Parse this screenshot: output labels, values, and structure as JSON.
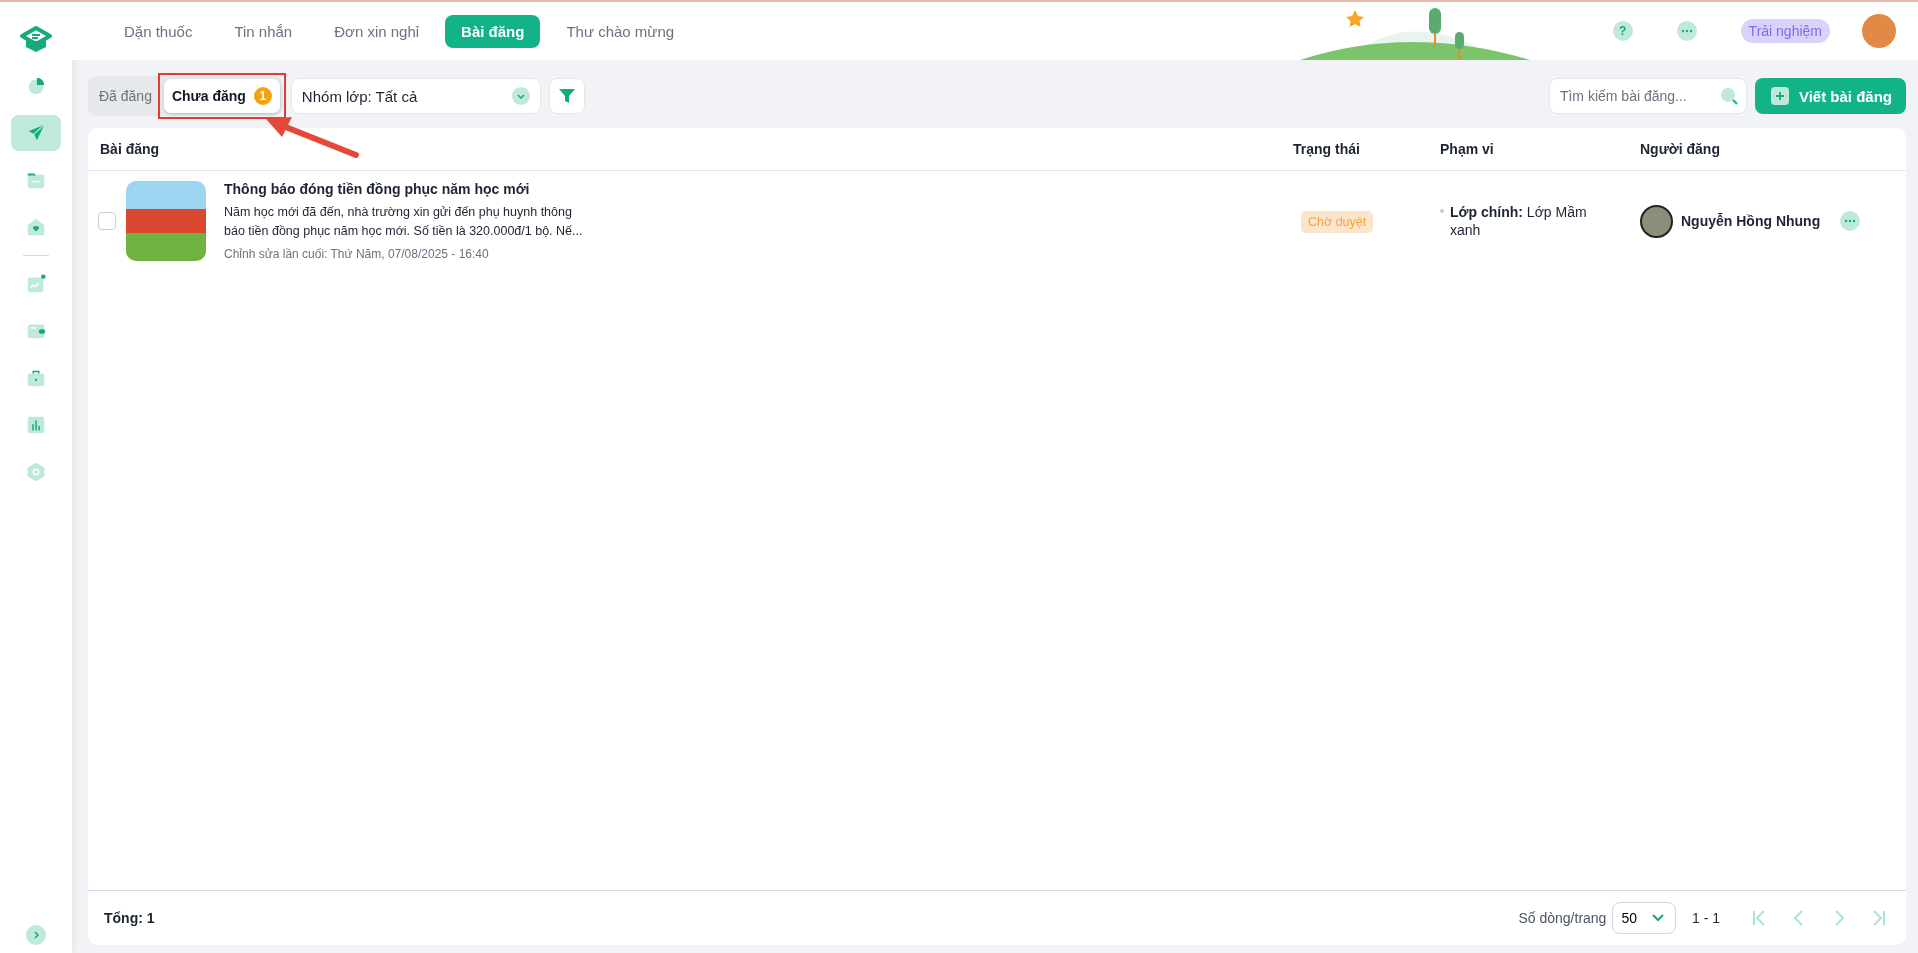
{
  "sidebar": {
    "groups": [
      [
        {
          "kind": "pie",
          "selected": false
        },
        {
          "kind": "send",
          "selected": true
        },
        {
          "kind": "folder",
          "selected": false
        },
        {
          "kind": "home",
          "selected": false
        }
      ],
      [
        {
          "kind": "trend",
          "selected": false
        },
        {
          "kind": "wallet",
          "selected": false
        },
        {
          "kind": "briefcase",
          "selected": false
        },
        {
          "kind": "bars",
          "selected": false
        },
        {
          "kind": "hexagon",
          "selected": false
        }
      ]
    ]
  },
  "top_tabs": [
    {
      "label": "Dặn thuốc",
      "selected": false
    },
    {
      "label": "Tin nhắn",
      "selected": false
    },
    {
      "label": "Đơn xin nghỉ",
      "selected": false
    },
    {
      "label": "Bài đăng",
      "selected": true
    },
    {
      "label": "Thư chào mừng",
      "selected": false
    }
  ],
  "header": {
    "help": "?",
    "trial_button": "Trải nghiệm"
  },
  "status_tabs": [
    {
      "label": "Đã đăng",
      "selected": false,
      "highlighted": false
    },
    {
      "label": "Chưa đăng",
      "badge": "1",
      "selected": true,
      "highlighted": true
    }
  ],
  "class_filter": {
    "value": "Nhóm lớp: Tất cả"
  },
  "search": {
    "placeholder": "Tìm kiếm bài đăng..."
  },
  "new_post_button": "Viết bài đăng",
  "table": {
    "columns": [
      "Bài đăng",
      "Trạng thái",
      "Phạm vi",
      "Người đăng"
    ],
    "rows": [
      {
        "checked": false,
        "title": "Thông báo đóng tiền đồng phục năm học mới",
        "excerpt": "Năm học mới đã đến, nhà trường xin gửi đến phụ huynh thông báo tiền đồng phục năm học mới. Số tiền là 320.000đ/1 bộ. Nế...",
        "edited": "Chỉnh sửa lần cuối: Thứ Năm, 07/08/2025 - 16:40",
        "status": "Chờ duyệt",
        "scope": "**Lớp chính:** Lớp Mầm xanh",
        "author": "Nguyễn Hồng Nhung"
      }
    ]
  },
  "footer": {
    "total": "Tổng: 1",
    "rows_per_page_label": "Số dòng/trang",
    "rows_per_page": "50",
    "range": "1 - 1"
  }
}
